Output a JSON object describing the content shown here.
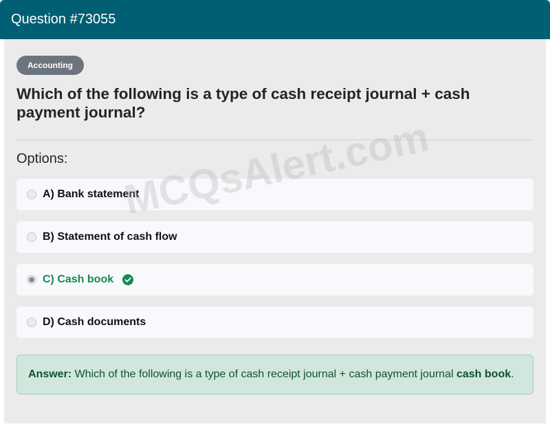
{
  "header": {
    "title": "Question #73055"
  },
  "category": {
    "label": "Accounting"
  },
  "question": {
    "text": "Which of the following is a type of cash receipt journal + cash payment journal?"
  },
  "options": {
    "title": "Options:",
    "items": [
      {
        "label": "A) Bank statement",
        "selected": false,
        "correct": false
      },
      {
        "label": "B) Statement of cash flow",
        "selected": false,
        "correct": false
      },
      {
        "label": "C) Cash book",
        "selected": true,
        "correct": true
      },
      {
        "label": "D) Cash documents",
        "selected": false,
        "correct": false
      }
    ]
  },
  "answer": {
    "prefix": "Answer:",
    "text": " Which of the following is a type of cash receipt journal + cash payment journal ",
    "highlight": "cash book",
    "suffix": "."
  },
  "watermark": {
    "text": "MCQsAlert.com"
  },
  "colors": {
    "header_bg": "#005f73",
    "badge_bg": "#6c757d",
    "correct": "#198754",
    "answer_bg": "#d1e7dd"
  },
  "icons": {
    "correct": "check-circle-icon"
  }
}
